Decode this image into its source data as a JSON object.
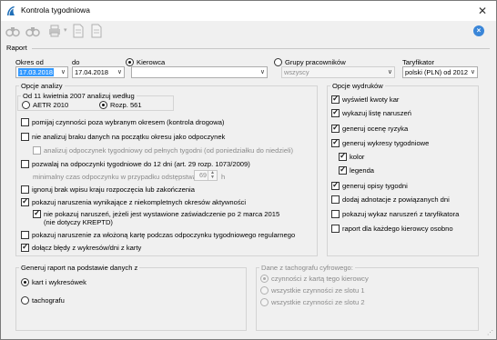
{
  "window": {
    "title": "Kontrola tygodniowa"
  },
  "toolbar": {
    "icons": [
      "binoculars-icon",
      "binoculars-icon",
      "print-icon",
      "dropdown-arrow-icon",
      "document-icon",
      "document-icon"
    ]
  },
  "raport": {
    "header": "Raport",
    "okres_od_label": "Okres od",
    "okres_od_value": "17.03.2018",
    "do_label": "do",
    "do_value": "17.04.2018",
    "kierowca_label": "Kierowca",
    "kierowca_value": "",
    "grupy_label": "Grupy pracowników",
    "grupy_value": "wszyscy",
    "taryfikator_label": "Taryfikator",
    "taryfikator_value": "polski (PLN) od 2012"
  },
  "opcje_analizy": {
    "title": "Opcje analizy",
    "subgroup_title": "Od 11 kwietnia 2007 analizuj według",
    "aetr_label": "AETR 2010",
    "rozp_label": "Rozp. 561",
    "opt1": "pomijaj czynności poza wybranym okresem (kontrola drogowa)",
    "opt2": "nie analizuj braku danych na początku okresu jako odpoczynek",
    "opt3": "analizuj odpoczynek tygodniowy od pełnych tygodni (od poniedziałku do niedzieli)",
    "opt4": "pozwalaj na odpoczynki tygodniowe do 12 dni (art. 29 rozp. 1073/2009)",
    "min_czas_label": "minimalny czas odpoczynku w przypadku odstępstwa",
    "min_czas_value": "69",
    "min_czas_unit": "h",
    "opt5": "ignoruj brak wpisu kraju rozpoczęcia lub zakończenia",
    "opt6": "pokazuj naruszenia wynikające z niekompletnych okresów aktywności",
    "opt7_line1": "nie pokazuj naruszeń, jeżeli jest wystawione zaświadczenie po 2 marca 2015",
    "opt7_line2": "(nie dotyczy KREPTD)",
    "opt8": "pokazuj naruszenie za włożoną kartę podczas odpoczynku tygodniowego regularnego",
    "opt9": "dołącz błędy z wykresów/dni z karty"
  },
  "opcje_wydrukow": {
    "title": "Opcje wydruków",
    "o1": "wyświetl kwoty kar",
    "o2": "wykazuj listę naruszeń",
    "o3": "generuj ocenę ryzyka",
    "o4": "generuj wykresy tygodniowe",
    "o4a": "kolor",
    "o4b": "legenda",
    "o5": "generuj opisy tygodni",
    "o6": "dodaj adnotacje z powiązanych dni",
    "o7": "pokazuj wykaz naruszeń z taryfikatora",
    "o8": "raport dla każdego kierowcy osobno"
  },
  "generuj": {
    "title": "Generuj raport na podstawie danych z",
    "r1": "kart i wykresówek",
    "r2": "tachografu"
  },
  "tachograf": {
    "title": "Dane z tachografu cyfrowego:",
    "r1": "czynności z kartą tego kierowcy",
    "r2": "wszystkie czynności ze slotu 1",
    "r3": "wszystkie czynności ze slotu 2"
  }
}
